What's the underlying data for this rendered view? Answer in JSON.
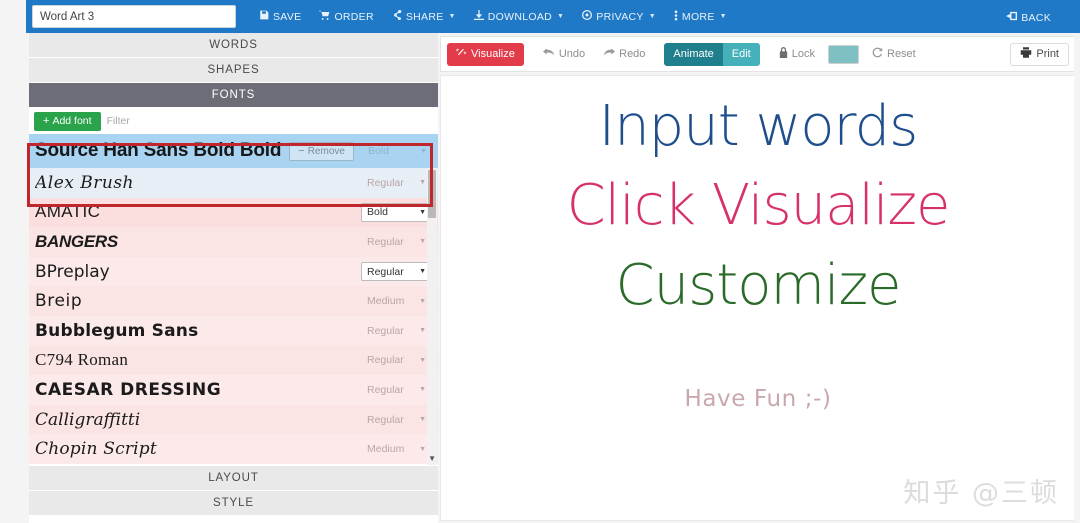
{
  "topbar": {
    "title_value": "Word Art 3",
    "title_placeholder": "Word Art 3",
    "nav": [
      {
        "label": "SAVE",
        "icon": "save-icon",
        "glyph": "ὋE",
        "caret": false
      },
      {
        "label": "ORDER",
        "icon": "cart-icon",
        "glyph": "\u0000",
        "caret": false
      },
      {
        "label": "SHARE",
        "icon": "share-icon",
        "glyph": "\u0000",
        "caret": true
      },
      {
        "label": "DOWNLOAD",
        "icon": "download-icon",
        "glyph": "\u0000",
        "caret": true
      },
      {
        "label": "PRIVACY",
        "icon": "privacy-icon",
        "glyph": "\u0000",
        "caret": true
      },
      {
        "label": "MORE",
        "icon": "more-icon",
        "glyph": "\u0000",
        "caret": true
      }
    ],
    "back_label": "BACK",
    "back_icon": "back-arrow-icon",
    "bg_color": "#2079c7"
  },
  "sidebar": {
    "sections_above": [
      {
        "label": "WORDS",
        "active": false
      },
      {
        "label": "SHAPES",
        "active": false
      },
      {
        "label": "FONTS",
        "active": true
      }
    ],
    "sections_below": [
      {
        "label": "LAYOUT",
        "active": false
      },
      {
        "label": "STYLE",
        "active": false
      }
    ],
    "highlight_color": "#c0272d"
  },
  "fonts_panel": {
    "add_font_label": "Add font",
    "add_font_icon": "plus-icon",
    "add_font_color": "#2aa34a",
    "filter_placeholder": "Filter",
    "filter_value": "",
    "selected": {
      "name": "Source Han Sans Bold Bold",
      "remove_label": "Remove",
      "remove_icon": "minus-icon",
      "weight": "Bold",
      "weight_enabled": false,
      "row_color": "#a8d4f2"
    },
    "list": [
      {
        "name": "Alex Brush",
        "weight": "Regular",
        "enabled": false,
        "style": "ff-script",
        "row": "fr-a"
      },
      {
        "name": "AMATIC",
        "weight": "Bold",
        "enabled": true,
        "style": "ff-cond",
        "row": "fr-b"
      },
      {
        "name": "BANGERS",
        "weight": "Regular",
        "enabled": false,
        "style": "ff-heavy",
        "row": "fr-c"
      },
      {
        "name": "BPreplay",
        "weight": "Regular",
        "enabled": true,
        "style": "ff-plain",
        "row": "fr-d"
      },
      {
        "name": "Breip",
        "weight": "Medium",
        "enabled": false,
        "style": "ff-hand",
        "row": "fr-c"
      },
      {
        "name": "Bubblegum Sans",
        "weight": "Regular",
        "enabled": false,
        "style": "ff-round",
        "row": "fr-d"
      },
      {
        "name": "C794 Roman",
        "weight": "Regular",
        "enabled": false,
        "style": "ff-serif",
        "row": "fr-c"
      },
      {
        "name": "CAESAR DRESSING",
        "weight": "Regular",
        "enabled": false,
        "style": "ff-deco",
        "row": "fr-d"
      },
      {
        "name": "Calligraffitti",
        "weight": "Regular",
        "enabled": false,
        "style": "ff-calli",
        "row": "fr-c"
      },
      {
        "name": "Chopin Script",
        "weight": "Medium",
        "enabled": false,
        "style": "ff-chopin",
        "row": "fr-d"
      }
    ],
    "scroll_down_glyph": "▼"
  },
  "toolbar": {
    "visualize_label": "Visualize",
    "visualize_icon": "wand-icon",
    "visualize_color": "#e23b4a",
    "undo_label": "Undo",
    "undo_icon": "undo-arrow-icon",
    "redo_label": "Redo",
    "redo_icon": "redo-arrow-icon",
    "animate_label": "Animate",
    "animate_color": "#1f7f8c",
    "edit_label": "Edit",
    "edit_color": "#45afba",
    "lock_label": "Lock",
    "lock_icon": "lock-icon",
    "color_swatch": "#7fc0c4",
    "reset_label": "Reset",
    "reset_icon": "reset-circle-icon",
    "print_label": "Print",
    "print_icon": "printer-icon"
  },
  "canvas": {
    "lines": [
      {
        "text": "Input words",
        "color": "#1f4e8c"
      },
      {
        "text": "Click Visualize",
        "color": "#d6316a"
      },
      {
        "text": "Customize",
        "color": "#2a6b2a"
      },
      {
        "text": "Have Fun ;-)",
        "color": "#c9a8ad"
      }
    ]
  },
  "watermark": {
    "text": "知乎 @三顿"
  }
}
